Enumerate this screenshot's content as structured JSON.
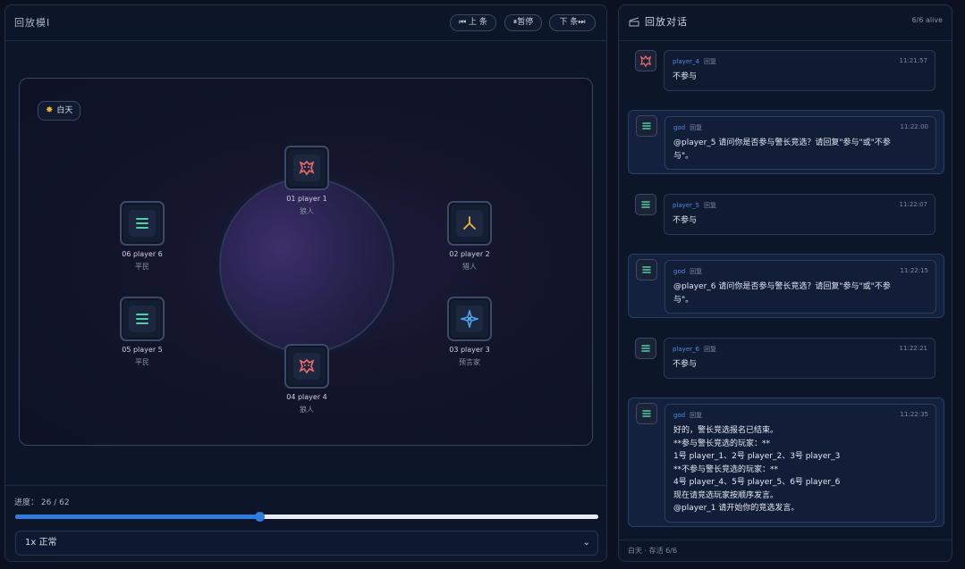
{
  "replay": {
    "title": "回放模Ⅰ",
    "controls": {
      "prev": "⏮ 上 条",
      "pause": "⏸暂停",
      "next": "下 条⏭"
    },
    "phase_label": "白天",
    "seats": [
      {
        "number_name": "01 player 1",
        "role": "狼人",
        "icon": "wolf-icon",
        "color": "#f06a6a"
      },
      {
        "number_name": "02 player 2",
        "role": "猎人",
        "icon": "hunter-icon",
        "color": "#f0b43a"
      },
      {
        "number_name": "03 player 3",
        "role": "预言家",
        "icon": "seer-icon",
        "color": "#4aa8f0"
      },
      {
        "number_name": "04 player 4",
        "role": "狼人",
        "icon": "wolf-icon",
        "color": "#f06a6a"
      },
      {
        "number_name": "05 player 5",
        "role": "平民",
        "icon": "villager-icon",
        "color": "#4fd0a0"
      },
      {
        "number_name": "06 player 6",
        "role": "平民",
        "icon": "villager-icon",
        "color": "#4fd0a0"
      }
    ],
    "progress": {
      "label": "进度：",
      "current": 26,
      "total": 62,
      "text": "26 / 62"
    },
    "speed": {
      "selected": "1x 正常"
    }
  },
  "chat": {
    "title": "回放对话",
    "alive": "6/6 alive",
    "messages": [
      {
        "speaker": "player_4",
        "tag": "回复",
        "time": "11:21:57",
        "lines": [
          "不参与"
        ],
        "avatar": "wolf-icon",
        "god": false
      },
      {
        "speaker": "god",
        "tag": "回复",
        "time": "11:22:00",
        "lines": [
          "@player_5 请问你是否参与警长竞选？请回复\"参与\"或\"不参",
          "与\"。"
        ],
        "avatar": "god-icon",
        "god": true
      },
      {
        "speaker": "player_5",
        "tag": "回复",
        "time": "11:22:07",
        "lines": [
          "不参与"
        ],
        "avatar": "villager-icon",
        "god": false
      },
      {
        "speaker": "god",
        "tag": "回复",
        "time": "11:22:15",
        "lines": [
          "@player_6 请问你是否参与警长竞选？请回复\"参与\"或\"不参",
          "与\"。"
        ],
        "avatar": "god-icon",
        "god": true
      },
      {
        "speaker": "player_6",
        "tag": "回复",
        "time": "11:22:21",
        "lines": [
          "不参与"
        ],
        "avatar": "villager-icon",
        "god": false
      },
      {
        "speaker": "god",
        "tag": "回复",
        "time": "11:22:35",
        "lines": [
          "好的，警长竞选报名已结束。",
          "**参与警长竞选的玩家：**",
          "1号 player_1、2号 player_2、3号 player_3",
          "**不参与警长竞选的玩家：**",
          "4号 player_4、5号 player_5、6号 player_6",
          "现在请竞选玩家按顺序发言。",
          "@player_1 请开始你的竞选发言。"
        ],
        "avatar": "god-icon",
        "god": true
      }
    ],
    "footer": "白天 · 存活 6/6"
  }
}
